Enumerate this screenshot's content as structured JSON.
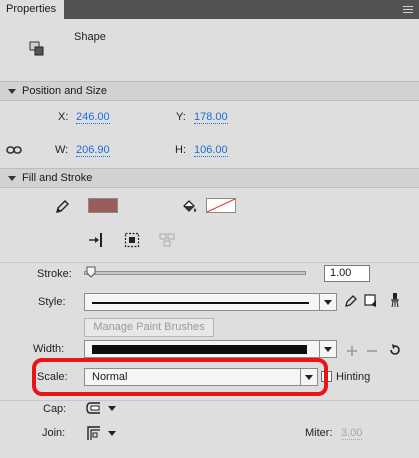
{
  "panel": {
    "tab_label": "Properties"
  },
  "object": {
    "type_label": "Shape"
  },
  "position_size": {
    "title": "Position and Size",
    "x_label": "X:",
    "x_value": "246.00",
    "y_label": "Y:",
    "y_value": "178.00",
    "w_label": "W:",
    "w_value": "206.90",
    "h_label": "H:",
    "h_value": "106.00"
  },
  "fill_stroke": {
    "title": "Fill and Stroke",
    "stroke_color": "#9b5d5b",
    "stroke_label": "Stroke:",
    "stroke_value": "1.00",
    "stroke_slider_level": 0.0,
    "style_label": "Style:",
    "manage_brushes_label": "Manage Paint Brushes",
    "width_label": "Width:",
    "scale_label": "Scale:",
    "scale_value": "Normal",
    "hinting_label": "Hinting",
    "hinting_checked": false,
    "cap_label": "Cap:",
    "join_label": "Join:",
    "miter_label": "Miter:",
    "miter_value": "3.00"
  },
  "annotation": {
    "highlight_color": "#e8141a"
  }
}
